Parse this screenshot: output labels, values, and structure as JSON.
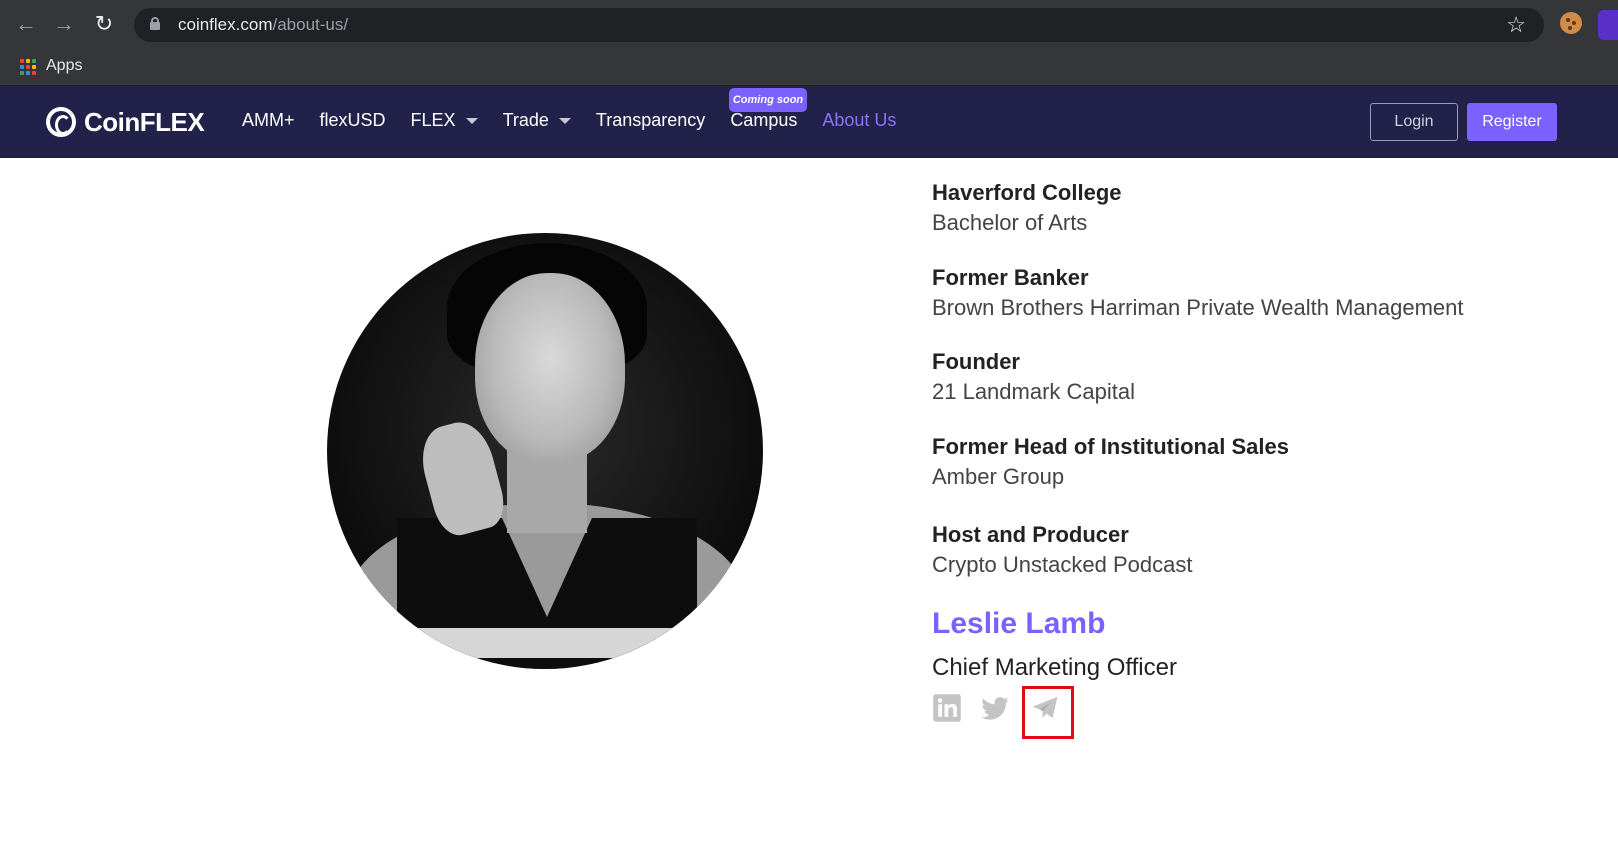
{
  "browser": {
    "url_domain": "coinflex.com",
    "url_path": "/about-us/",
    "bookmarks": {
      "apps_label": "Apps"
    },
    "icons": [
      "back-arrow-icon",
      "forward-arrow-icon",
      "reload-icon",
      "lock-icon",
      "star-icon",
      "apps-grid-icon"
    ]
  },
  "site": {
    "logo_text": "CoinFLEX",
    "nav": [
      {
        "label": "AMM+"
      },
      {
        "label": "flexUSD"
      },
      {
        "label": "FLEX",
        "dropdown": true
      },
      {
        "label": "Trade",
        "dropdown": true
      },
      {
        "label": "Transparency"
      },
      {
        "label": "Campus"
      },
      {
        "label": "About Us",
        "active": true
      }
    ],
    "badge": "Coming soon",
    "login_label": "Login",
    "register_label": "Register",
    "colors": {
      "header_bg": "#222149",
      "accent": "#7b61ff"
    }
  },
  "profile": {
    "credentials": [
      {
        "title": "Haverford College",
        "subtitle": "Bachelor of Arts"
      },
      {
        "title": "Former Banker",
        "subtitle": "Brown Brothers Harriman Private Wealth Management"
      },
      {
        "title": "Founder",
        "subtitle": "21 Landmark Capital"
      },
      {
        "title": "Former Head of Institutional Sales",
        "subtitle": "Amber Group"
      },
      {
        "title": "Host and Producer",
        "subtitle": "Crypto Unstacked Podcast"
      }
    ],
    "name": "Leslie Lamb",
    "role": "Chief Marketing Officer",
    "social_icons": [
      "linkedin-icon",
      "twitter-icon",
      "telegram-icon"
    ]
  }
}
